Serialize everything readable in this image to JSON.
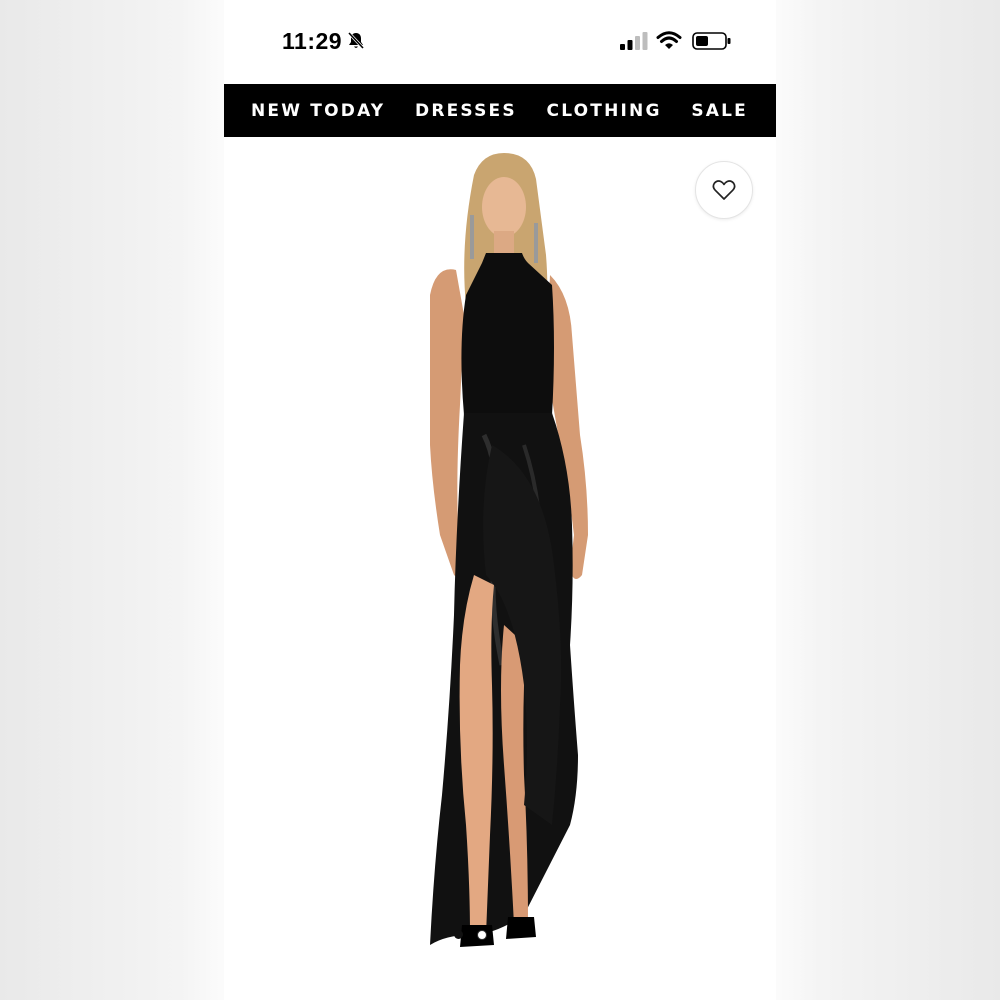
{
  "status_bar": {
    "time": "11:29",
    "icons": [
      "bell-slash-icon",
      "cellular-signal-icon",
      "wifi-icon",
      "battery-icon"
    ]
  },
  "nav": {
    "items": [
      {
        "label": "NEW TODAY"
      },
      {
        "label": "DRESSES"
      },
      {
        "label": "CLOTHING"
      },
      {
        "label": "SALE"
      }
    ]
  },
  "product": {
    "image": "model-in-black-halter-maxi-dress",
    "wishlist_icon": "heart-icon",
    "carousel": {
      "slides": 2,
      "active_index": 0
    }
  },
  "colors": {
    "nav_bg": "#000000",
    "nav_text": "#ffffff",
    "page_bg": "#ffffff"
  }
}
